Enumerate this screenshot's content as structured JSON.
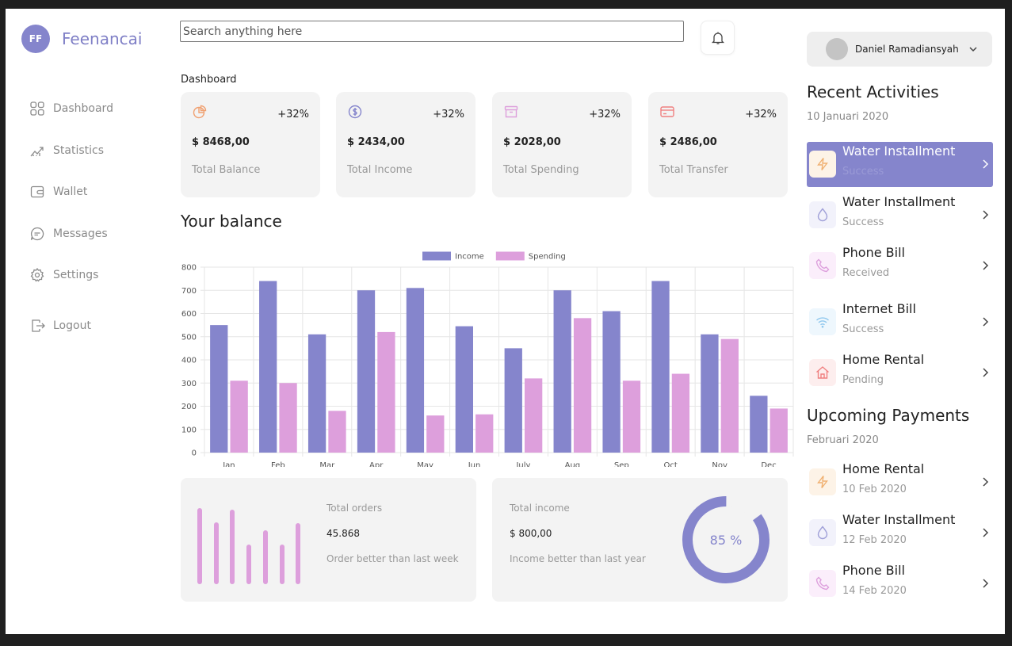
{
  "brand": {
    "badge": "FF",
    "name": "Feenancai"
  },
  "nav": [
    {
      "label": "Dashboard",
      "icon": "grid-icon"
    },
    {
      "label": "Statistics",
      "icon": "chart-trend-icon"
    },
    {
      "label": "Wallet",
      "icon": "wallet-icon"
    },
    {
      "label": "Messages",
      "icon": "chat-icon"
    },
    {
      "label": "Settings",
      "icon": "gear-icon"
    }
  ],
  "logout": "Logout",
  "search": {
    "placeholder": "Search anything here"
  },
  "section": "Dashboard",
  "cards": [
    {
      "percent": "+32%",
      "amount": "$ 8468,00",
      "label": "Total Balance",
      "icon": "pie-chart-icon",
      "color": "#f0a070"
    },
    {
      "percent": "+32%",
      "amount": "$ 2434,00",
      "label": "Total Income",
      "icon": "dollar-coin-icon",
      "color": "#8585cc"
    },
    {
      "percent": "+32%",
      "amount": "$ 2028,00",
      "label": "Total Spending",
      "icon": "archive-box-icon",
      "color": "#dd9fdc"
    },
    {
      "percent": "+32%",
      "amount": "$ 2486,00",
      "label": "Total Transfer",
      "icon": "credit-card-icon",
      "color": "#f08080"
    }
  ],
  "balance_title": "Your balance",
  "chart_data": {
    "type": "bar",
    "categories": [
      "Jan",
      "Feb",
      "Mar",
      "Apr",
      "May",
      "Jun",
      "July",
      "Aug",
      "Sep",
      "Oct",
      "Nov",
      "Dec"
    ],
    "series": [
      {
        "name": "Income",
        "color": "#8585cc",
        "values": [
          550,
          740,
          510,
          700,
          710,
          545,
          450,
          700,
          610,
          740,
          510,
          245
        ]
      },
      {
        "name": "Spending",
        "color": "#dd9fdc",
        "values": [
          310,
          300,
          180,
          520,
          160,
          165,
          320,
          580,
          310,
          340,
          490,
          190
        ]
      }
    ],
    "yticks": [
      0,
      100,
      200,
      300,
      400,
      500,
      600,
      700,
      800
    ],
    "ylim": [
      0,
      800
    ],
    "grid": true,
    "legend": "top-center"
  },
  "orders": {
    "title": "Total orders",
    "value": "45.868",
    "note": "Order better than last week",
    "bar_levels": [
      0.97,
      0.79,
      0.95,
      0.5,
      0.69,
      0.5,
      0.78
    ]
  },
  "income": {
    "title": "Total income",
    "value": "$ 800,00",
    "note": "Income better than last year",
    "percent_label": "85 %",
    "progress": 0.85
  },
  "profile": {
    "name": "Daniel Ramadiansyah"
  },
  "recent": {
    "title": "Recent Activities",
    "date": "10 Januari 2020",
    "items": [
      {
        "name": "Water Installment",
        "status": "Success",
        "icon": "lightning-icon",
        "color": "#f0b070",
        "bg": "#fdf3e7",
        "active": true
      },
      {
        "name": "Water Installment",
        "status": "Success",
        "icon": "water-drop-icon",
        "color": "#a0a0d8",
        "bg": "#f2f2fb"
      },
      {
        "name": "Phone Bill",
        "status": "Received",
        "icon": "phone-icon",
        "color": "#dd9fdc",
        "bg": "#fbeefb"
      },
      {
        "name": "Internet Bill",
        "status": "Success",
        "icon": "wifi-icon",
        "color": "#90c8ee",
        "bg": "#eef7fd"
      },
      {
        "name": "Home Rental",
        "status": "Pending",
        "icon": "home-icon",
        "color": "#f08080",
        "bg": "#fdeeee"
      }
    ]
  },
  "upcoming": {
    "title": "Upcoming Payments",
    "date": "Februari 2020",
    "items": [
      {
        "name": "Home Rental",
        "status": "10 Feb 2020",
        "icon": "lightning-icon",
        "color": "#f0b070",
        "bg": "#fdf3e7"
      },
      {
        "name": "Water Installment",
        "status": "12 Feb 2020",
        "icon": "water-drop-icon",
        "color": "#a0a0d8",
        "bg": "#f2f2fb"
      },
      {
        "name": "Phone Bill",
        "status": "14 Feb 2020",
        "icon": "phone-icon",
        "color": "#dd9fdc",
        "bg": "#fbeefb"
      }
    ]
  }
}
